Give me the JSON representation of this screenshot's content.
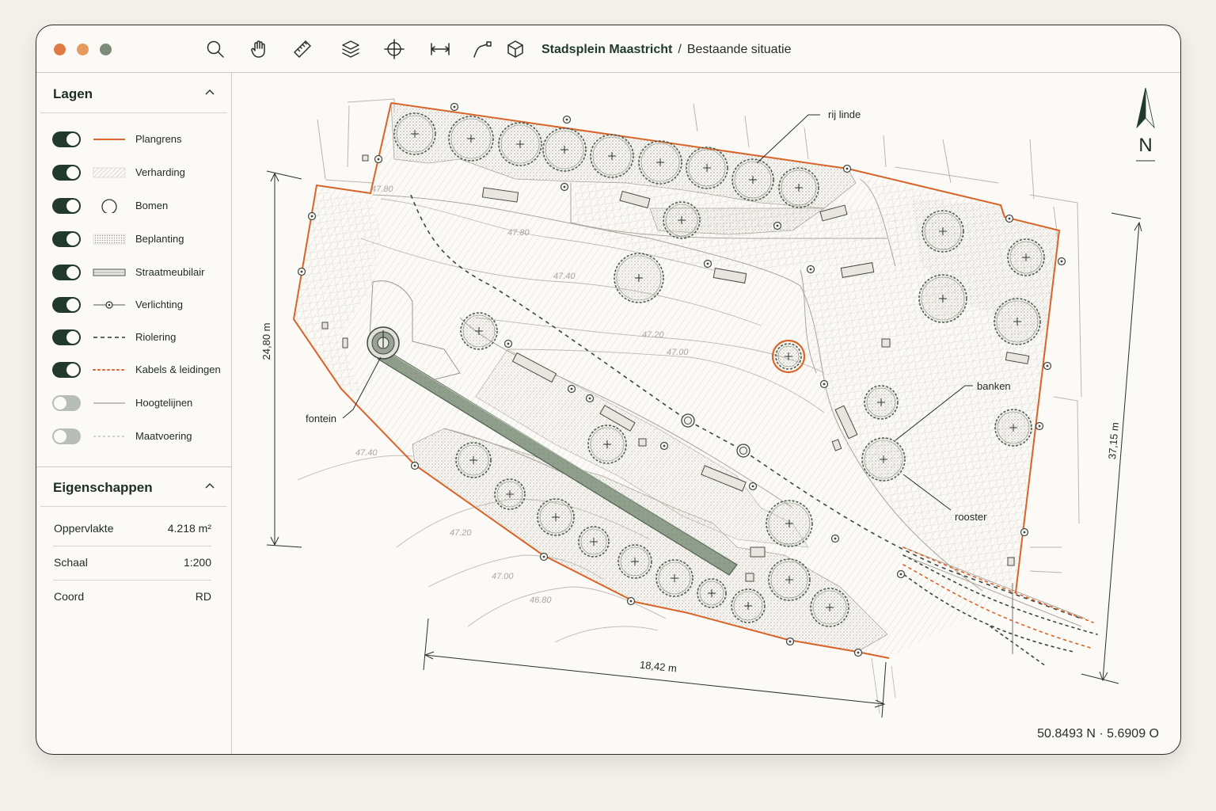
{
  "window": {
    "traffic_lights": [
      "#e07a45",
      "#e69a60",
      "#7d8c78"
    ]
  },
  "toolbar": {
    "tools": [
      {
        "name": "search-icon"
      },
      {
        "name": "hand-pan-icon"
      },
      {
        "name": "ruler-icon"
      },
      {
        "name": "layers-icon"
      },
      {
        "name": "crosshair-icon"
      },
      {
        "name": "dimension-icon"
      },
      {
        "name": "polyline-icon"
      },
      {
        "name": "cube-3d-icon"
      }
    ]
  },
  "breadcrumb": {
    "project": "Stadsplein Maastricht",
    "separator": "/",
    "view": "Bestaande situatie"
  },
  "layers_panel": {
    "title": "Lagen",
    "items": [
      {
        "label": "Plangrens",
        "enabled": true,
        "symbol": "orange-line"
      },
      {
        "label": "Verharding",
        "enabled": true,
        "symbol": "hatch-swatch"
      },
      {
        "label": "Bomen",
        "enabled": true,
        "symbol": "circle"
      },
      {
        "label": "Beplanting",
        "enabled": true,
        "symbol": "stipple-swatch"
      },
      {
        "label": "Straatmeubilair",
        "enabled": true,
        "symbol": "bench-rect"
      },
      {
        "label": "Verlichting",
        "enabled": true,
        "symbol": "lamp-line"
      },
      {
        "label": "Riolering",
        "enabled": true,
        "symbol": "dashed-line"
      },
      {
        "label": "Kabels & leidingen",
        "enabled": true,
        "symbol": "dotted-orange-line"
      },
      {
        "label": "Hoogtelijnen",
        "enabled": false,
        "symbol": "thin-line"
      },
      {
        "label": "Maatvoering",
        "enabled": false,
        "symbol": "thin-dashed-line"
      }
    ]
  },
  "properties_panel": {
    "title": "Eigenschappen",
    "rows": [
      {
        "key": "Oppervlakte",
        "value": "4.218 m²"
      },
      {
        "key": "Schaal",
        "value": "1:200"
      },
      {
        "key": "Coord",
        "value": "RD"
      }
    ]
  },
  "map": {
    "north_label": "N",
    "annotations": {
      "rij_linde": "rij linde",
      "fontein": "fontein",
      "banken": "banken",
      "rooster": "rooster"
    },
    "dimensions": {
      "left": "24,80 m",
      "bottom": "18,42 m",
      "right": "37,15 m"
    },
    "contours": [
      "47.80",
      "47.80",
      "47.40",
      "47.20",
      "47.00",
      "47.40",
      "47.20",
      "47.00",
      "46.80"
    ],
    "coordinates": "50.8493 N  ·  5.6909 O"
  },
  "colors": {
    "boundary": "#d9642a",
    "dark_green": "#223a2c",
    "tree_stroke": "#4d5e50",
    "channel": "#8f9f8c"
  }
}
